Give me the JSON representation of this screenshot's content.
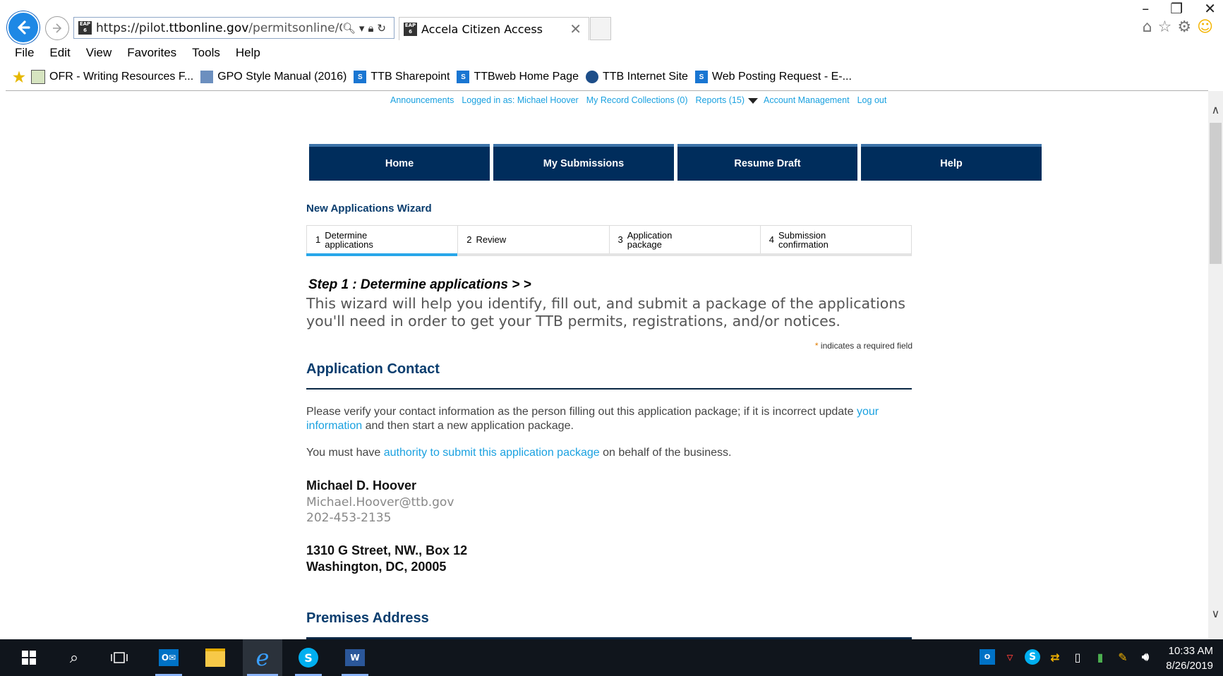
{
  "browser": {
    "url_prefix": "https://pilot.",
    "url_domain": "ttbonline.gov",
    "url_path": "/permitsonline/Cap",
    "tab_title": "Accela Citizen Access",
    "favicon_text": "EAP 6",
    "menu": [
      "File",
      "Edit",
      "View",
      "Favorites",
      "Tools",
      "Help"
    ],
    "favorites": [
      {
        "label": "OFR - Writing Resources F...",
        "icon": "ofr-icon"
      },
      {
        "label": "GPO Style Manual (2016)",
        "icon": "gpo-icon"
      },
      {
        "label": "TTB Sharepoint",
        "icon": "sharepoint-icon"
      },
      {
        "label": "TTBweb Home Page",
        "icon": "sharepoint-icon"
      },
      {
        "label": "TTB Internet Site",
        "icon": "ttb-seal-icon"
      },
      {
        "label": "Web Posting Request - E-...",
        "icon": "sharepoint-icon"
      }
    ]
  },
  "toplinks": {
    "announcements": "Announcements",
    "logged_in": "Logged in as: Michael Hoover",
    "collections": "My Record Collections (0)",
    "reports": "Reports (15)",
    "account": "Account Management",
    "logout": "Log out"
  },
  "nav_tabs": [
    "Home",
    "My Submissions",
    "Resume Draft",
    "Help"
  ],
  "wizard": {
    "title": "New Applications Wizard",
    "steps": [
      {
        "num": "1",
        "label": "Determine\napplications"
      },
      {
        "num": "2",
        "label": "Review"
      },
      {
        "num": "3",
        "label": "Application\npackage"
      },
      {
        "num": "4",
        "label": "Submission\nconfirmation"
      }
    ],
    "active_step": 1,
    "step_heading": "Step 1 : Determine applications > >",
    "intro": "This wizard will help you identify, fill out, and submit a package of the applications you'll need in order to get your TTB permits, registrations, and/or notices.",
    "required_star": "*",
    "required_text": "indicates a required field"
  },
  "contact": {
    "section_title": "Application Contact",
    "verify_before": "Please verify your contact information as the person filling out this application package; if it is incorrect update ",
    "verify_link": "your information",
    "verify_after": " and then start a new application package.",
    "authority_before": "You must have ",
    "authority_link": "authority to submit this application package",
    "authority_after": " on behalf of the business.",
    "name": "Michael D. Hoover",
    "email": "Michael.Hoover@ttb.gov",
    "phone": "202-453-2135",
    "address_line1": "1310 G Street, NW., Box 12",
    "address_line2": "Washington, DC, 20005"
  },
  "premises": {
    "section_title": "Premises Address"
  },
  "taskbar": {
    "time": "10:33 AM",
    "date": "8/26/2019"
  },
  "colors": {
    "nav_blue": "#002d5c",
    "link_blue": "#1aa1e0",
    "heading_blue": "#0a3d6e",
    "step_active": "#28a7e9",
    "required_orange": "#e07b00"
  }
}
